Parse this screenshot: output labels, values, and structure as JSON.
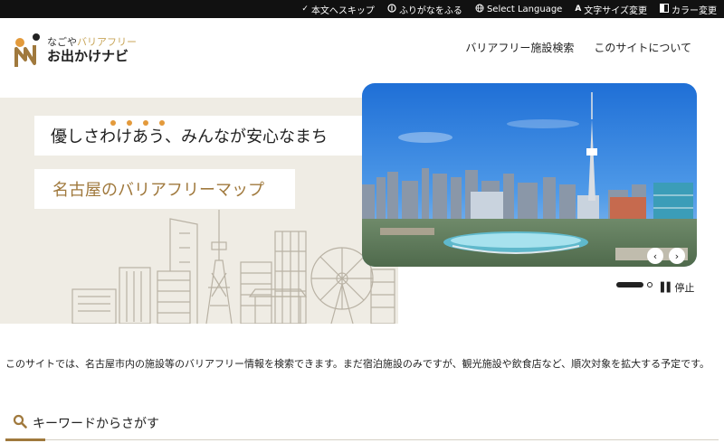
{
  "topbar": {
    "items": [
      {
        "icon": "check-icon",
        "label": "本文へスキップ"
      },
      {
        "icon": "furigana-icon",
        "label": "ふりがなをふる"
      },
      {
        "icon": "globe-icon",
        "label": "Select Language"
      },
      {
        "icon": "font-size-icon",
        "label": "文字サイズ変更"
      },
      {
        "icon": "contrast-icon",
        "label": "カラー変更"
      }
    ]
  },
  "logo": {
    "top_prefix": "なごや",
    "top_accent": "バリアフリー",
    "main": "お出かけナビ"
  },
  "nav": {
    "items": [
      "バリアフリー施設検索",
      "このサイトについて"
    ]
  },
  "hero": {
    "catch1": "優しさわけあう、みんなが安心なまち",
    "catch2": "名古屋のバリアフリーマップ",
    "slider": {
      "prev": "‹",
      "next": "›",
      "stop_label": "停止",
      "slide_count": 2,
      "current_slide": 1
    }
  },
  "intro": {
    "text": "このサイトでは、名古屋市内の施設等のバリアフリー情報を検索できます。まだ宿泊施設のみですが、観光施設や飲食店など、順次対象を拡大する予定です。"
  },
  "section": {
    "keyword_title": "キーワードからさがす"
  },
  "colors": {
    "accent_gold": "#a0793d",
    "dots_orange": "#e39a3b",
    "hero_bg": "#efece4",
    "topbar_bg": "#111111"
  }
}
